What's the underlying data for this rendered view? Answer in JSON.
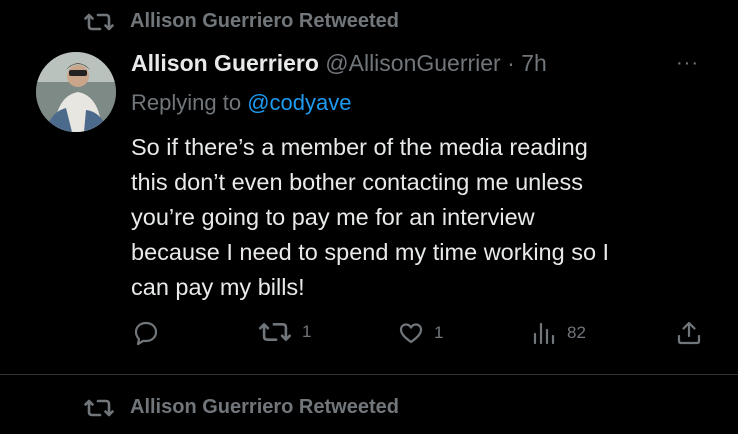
{
  "retweet_top": {
    "label": "Allison Guerriero Retweeted"
  },
  "tweet": {
    "display_name": "Allison Guerriero",
    "handle": "@AllisonGuerrier",
    "separator": "·",
    "time": "7h",
    "more": "···",
    "replying_prefix": "Replying to ",
    "replying_to": "@codyave",
    "text": "So if there’s a member of the media reading\nthis don’t even bother contacting me unless\nyou’re going to pay me for an interview\nbecause I need to spend my time working so I\ncan pay my bills!",
    "actions": {
      "reply_count": "",
      "retweet_count": "1",
      "like_count": "1",
      "views_count": "82"
    }
  },
  "retweet_bottom": {
    "label": "Allison Guerriero Retweeted"
  },
  "colors": {
    "background": "#000000",
    "text": "#e7e9ea",
    "muted": "#71767b",
    "link": "#1d9bf0",
    "divider": "#2f3336"
  },
  "icons": [
    "retweet-icon",
    "reply-icon",
    "like-icon",
    "views-icon",
    "share-icon",
    "more-icon"
  ]
}
